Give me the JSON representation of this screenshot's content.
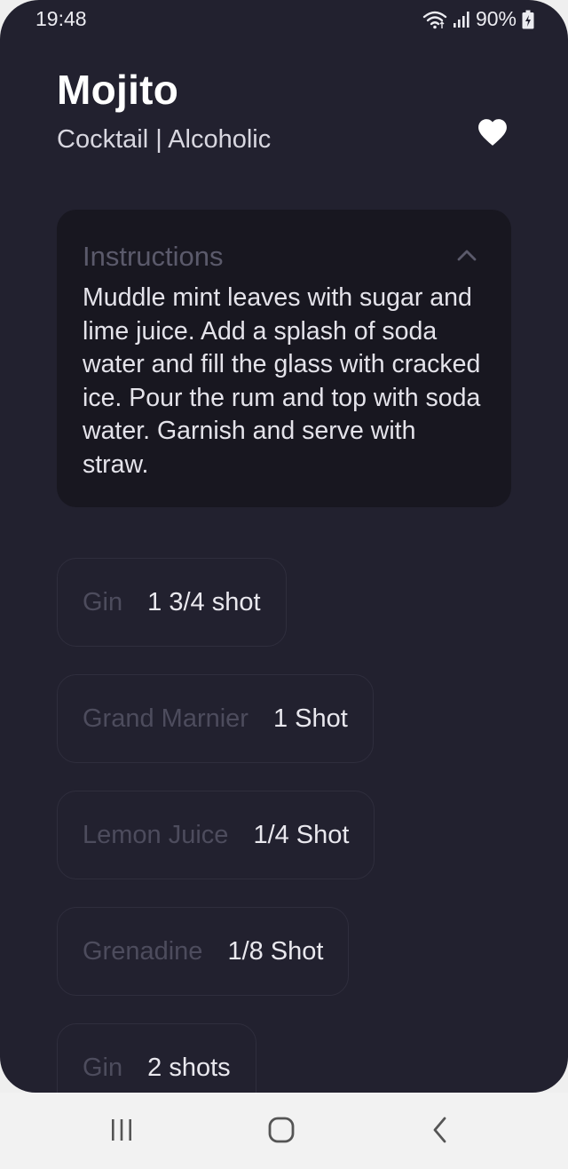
{
  "status_bar": {
    "time": "19:48",
    "battery": "90%",
    "icons": [
      "wifi-icon",
      "signal-icon",
      "battery-charging-icon"
    ]
  },
  "drink": {
    "name": "Mojito",
    "meta": "Cocktail | Alcoholic",
    "favorite_icon": "heart-icon"
  },
  "instructions": {
    "label": "Instructions",
    "toggle_icon": "chevron-up-icon",
    "text": "Muddle mint leaves with sugar and lime juice. Add a splash of soda water and fill the glass with cracked ice. Pour the rum and top with soda water. Garnish and serve with straw."
  },
  "ingredients": [
    {
      "name": "Gin",
      "measure": "1 3/4 shot"
    },
    {
      "name": "Grand Marnier",
      "measure": "1 Shot"
    },
    {
      "name": "Lemon Juice",
      "measure": "1/4 Shot"
    },
    {
      "name": "Grenadine",
      "measure": "1/8 Shot"
    },
    {
      "name": "Gin",
      "measure": "2 shots"
    }
  ],
  "nav_bar": {
    "icons": [
      "recent-apps-icon",
      "home-icon",
      "back-icon"
    ]
  },
  "colors": {
    "background": "#22212f",
    "card": "#181720",
    "muted_text": "#4d4c5d",
    "nav_background": "#f2f2f2"
  }
}
